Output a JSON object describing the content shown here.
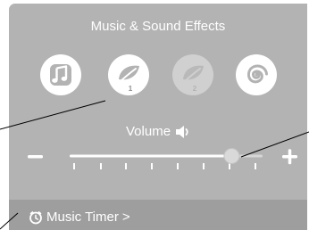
{
  "panel": {
    "title": "Music & Sound Effects"
  },
  "sounds": [
    {
      "icon": "music-note-icon",
      "state": "normal"
    },
    {
      "icon": "leaf-icon",
      "number": "1",
      "state": "selected"
    },
    {
      "icon": "leaf-icon",
      "number": "2",
      "state": "dimmed"
    },
    {
      "icon": "spiral-icon",
      "state": "normal"
    }
  ],
  "volume": {
    "label": "Volume",
    "icon": "speaker-icon",
    "level": 0.84,
    "decrease_symbol": "−",
    "increase_symbol": "+"
  },
  "timer": {
    "label": "Music Timer",
    "chevron": ">",
    "icon": "clock-icon"
  },
  "colors": {
    "panel": "#b3b3b3",
    "footer": "#9e9e9e",
    "foreground": "#ffffff",
    "icon_dark": "#b3b3b3",
    "callout_line": "#000000"
  }
}
